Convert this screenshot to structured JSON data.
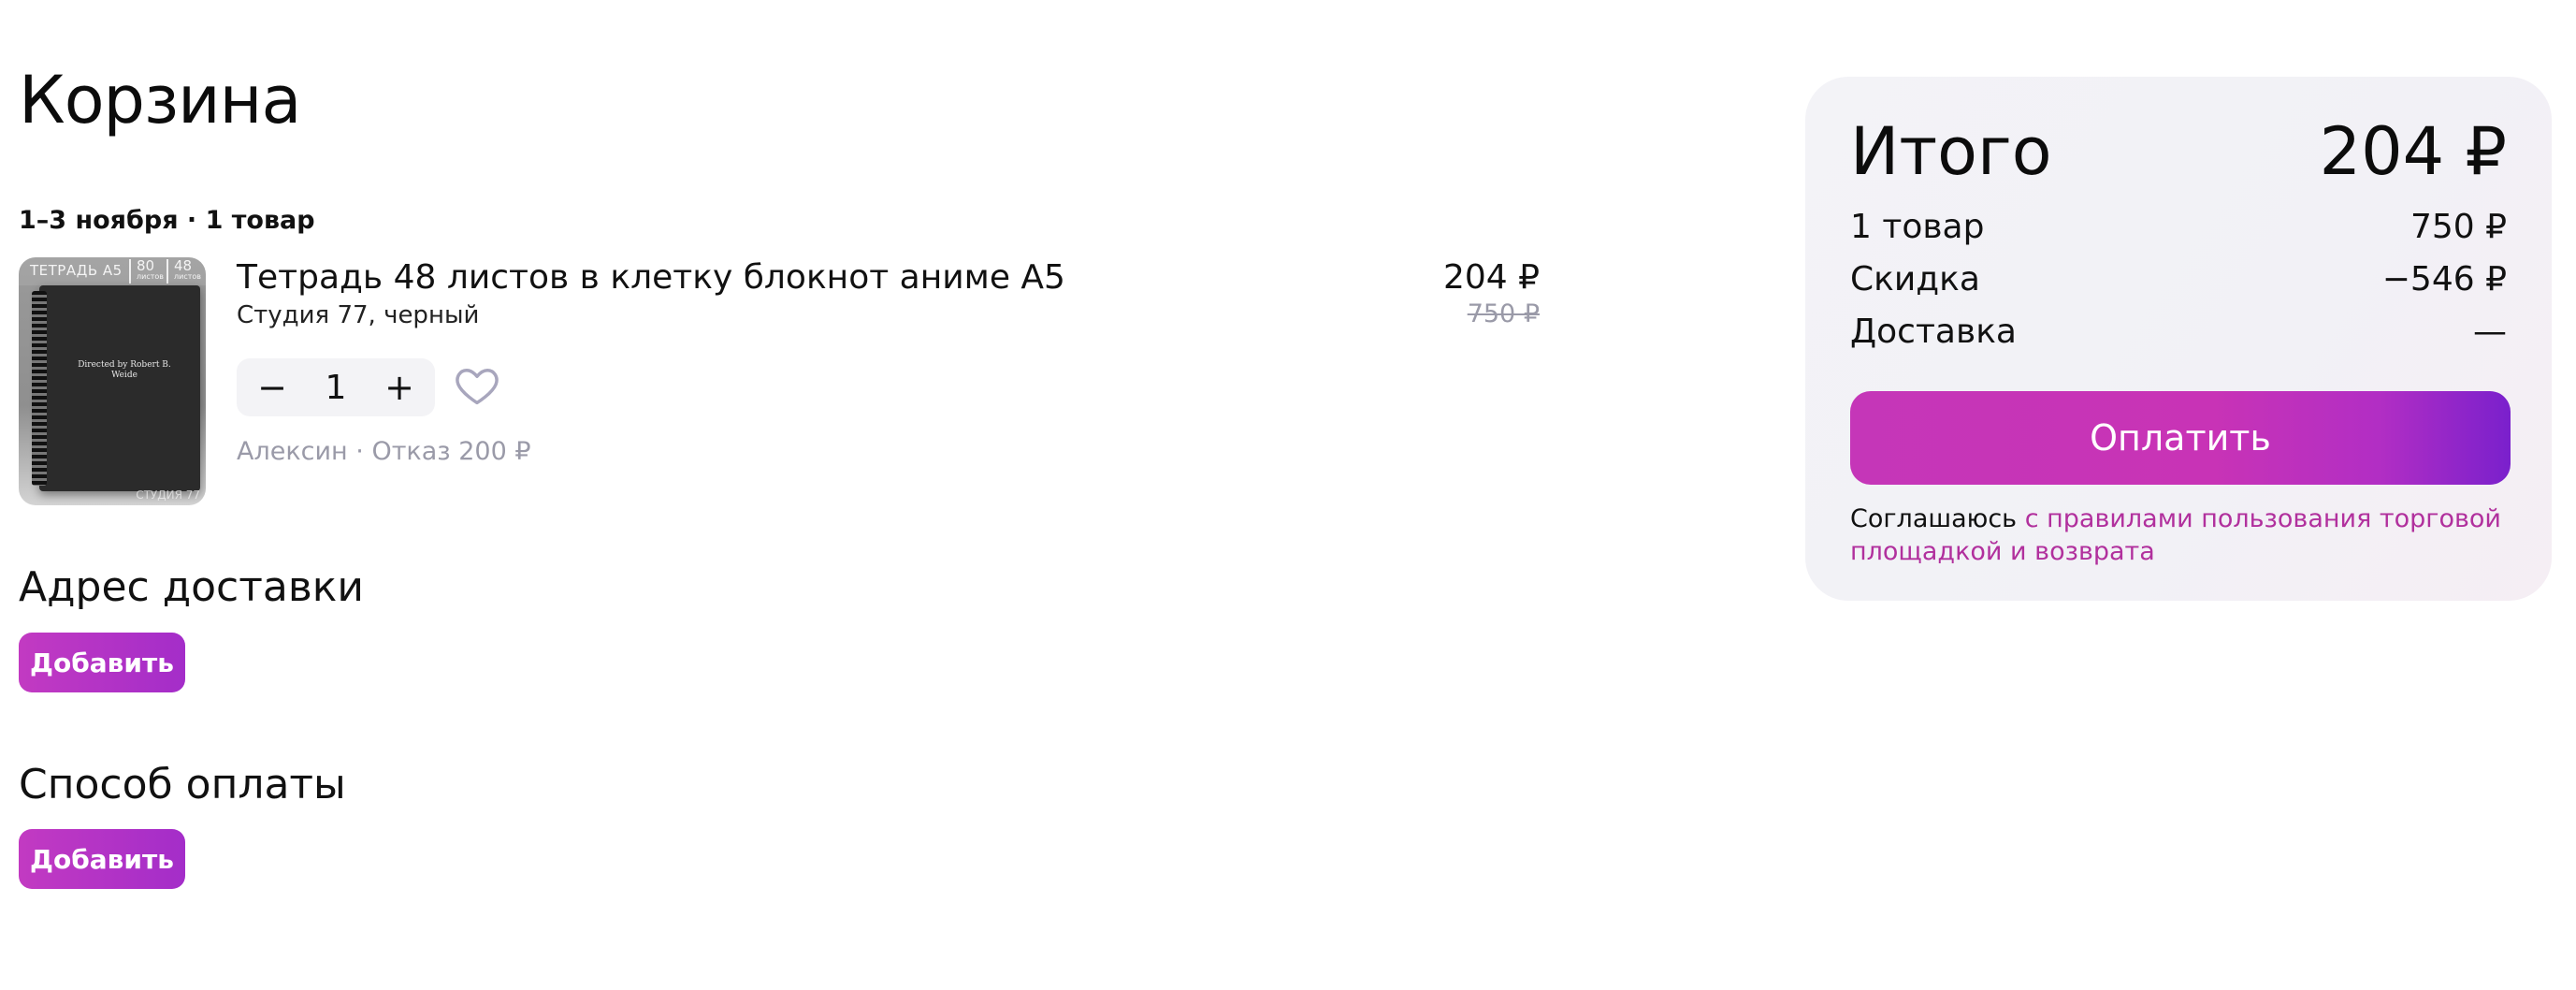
{
  "page": {
    "title": "Корзина"
  },
  "cart": {
    "delivery_meta": "1–3 ноября · 1 товар",
    "item": {
      "thumb": {
        "tag": "ТЕТРАДЬ А5",
        "sheets": "80",
        "sheets_unit": "листов",
        "pages": "48",
        "pages_unit": "листов",
        "cover_text": "Directed by Robert B. Weide",
        "watermark": "СТУДИЯ 77"
      },
      "name": "Тетрадь 48 листов в клетку блокнот аниме А5",
      "variant": "Студия 77, черный",
      "price": "204 ₽",
      "old_price": "750 ₽",
      "quantity": "1",
      "minus_label": "−",
      "plus_label": "+",
      "seller": "Алексин · Отказ 200 ₽"
    }
  },
  "address": {
    "title": "Адрес доставки",
    "add_label": "Добавить"
  },
  "payment": {
    "title": "Способ оплаты",
    "add_label": "Добавить"
  },
  "summary": {
    "total_label": "Итого",
    "total_value": "204 ₽",
    "rows": [
      {
        "label": "1 товар",
        "value": "750 ₽"
      },
      {
        "label": "Скидка",
        "value": "−546 ₽"
      },
      {
        "label": "Доставка",
        "value": "—"
      }
    ],
    "pay_label": "Оплатить",
    "terms_prefix": "Соглашаюсь ",
    "terms_link": "с правилами пользования торговой площадкой и возврата"
  },
  "colors": {
    "accent": "#c23ac2",
    "accent_dark": "#7a20cc",
    "link": "#b1309d",
    "muted": "#9a9aa8"
  }
}
